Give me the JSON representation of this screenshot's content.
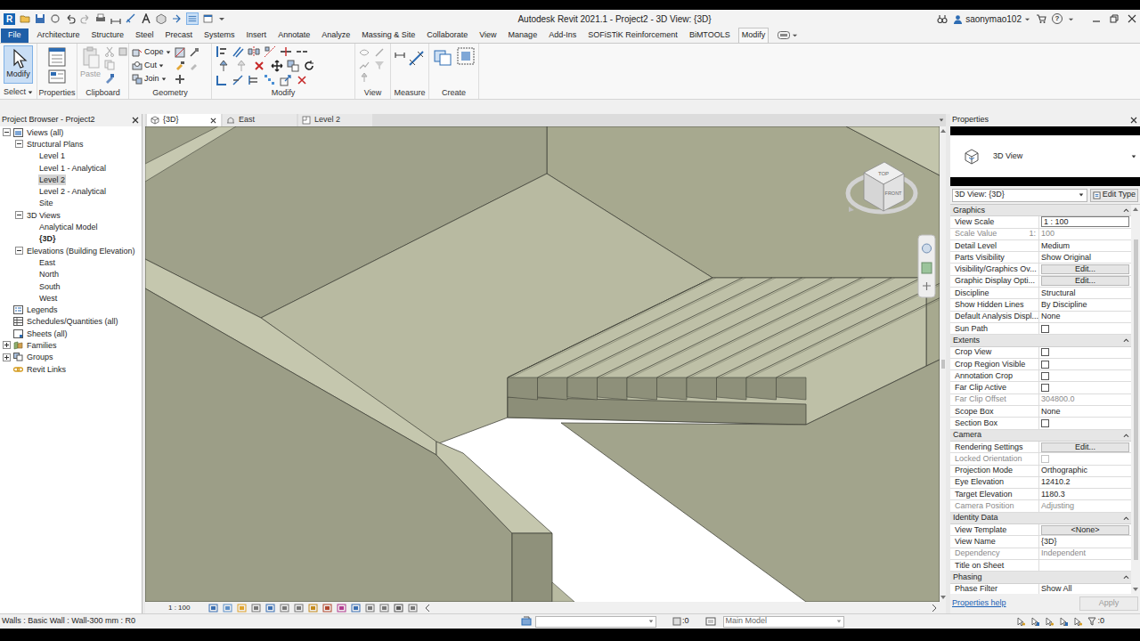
{
  "window": {
    "logo": "R",
    "title": "Autodesk Revit 2021.1 - Project2 - 3D View: {3D}",
    "user": "saonymao102",
    "help": "?"
  },
  "ribbon_tabs": [
    {
      "label": "File",
      "kind": "application",
      "selected": false
    },
    {
      "label": "Architecture",
      "kind": "tab",
      "selected": false
    },
    {
      "label": "Structure",
      "kind": "tab",
      "selected": false
    },
    {
      "label": "Steel",
      "kind": "tab",
      "selected": false
    },
    {
      "label": "Precast",
      "kind": "tab",
      "selected": false
    },
    {
      "label": "Systems",
      "kind": "tab",
      "selected": false
    },
    {
      "label": "Insert",
      "kind": "tab",
      "selected": false
    },
    {
      "label": "Annotate",
      "kind": "tab",
      "selected": false
    },
    {
      "label": "Analyze",
      "kind": "tab",
      "selected": false
    },
    {
      "label": "Massing & Site",
      "kind": "tab",
      "selected": false
    },
    {
      "label": "Collaborate",
      "kind": "tab",
      "selected": false
    },
    {
      "label": "View",
      "kind": "tab",
      "selected": false
    },
    {
      "label": "Manage",
      "kind": "tab",
      "selected": false
    },
    {
      "label": "Add-Ins",
      "kind": "tab",
      "selected": false
    },
    {
      "label": "SOFiSTiK Reinforcement",
      "kind": "tab",
      "selected": false
    },
    {
      "label": "BiMTOOLS",
      "kind": "tab",
      "selected": false
    },
    {
      "label": "Modify",
      "kind": "tab",
      "selected": true
    }
  ],
  "ribbon": {
    "select": {
      "button": "Modify",
      "button_selected": true,
      "label": "Select",
      "dropdown": true
    },
    "properties": {
      "label": "Properties"
    },
    "clipboard": {
      "paste": "Paste",
      "paste_disabled": true,
      "label": "Clipboard"
    },
    "geometry": {
      "tools": [
        {
          "label": "Cope",
          "dropdown": true
        },
        {
          "label": "Cut",
          "dropdown": true
        },
        {
          "label": "Join",
          "dropdown": true
        }
      ],
      "label": "Geometry"
    },
    "modify": {
      "label": "Modify"
    },
    "view": {
      "label": "View"
    },
    "measure": {
      "label": "Measure"
    },
    "create": {
      "label": "Create"
    }
  },
  "browser": {
    "title": "Project Browser - Project2",
    "tree": [
      {
        "label": "Views (all)",
        "kind": "views",
        "expanded": true,
        "selected": false,
        "open": false,
        "children": [
          {
            "label": "Structural Plans",
            "kind": "folder",
            "expanded": true,
            "selected": false,
            "open": false,
            "children": [
              {
                "label": "Level 1",
                "kind": "view",
                "selected": false,
                "open": false
              },
              {
                "label": "Level 1 - Analytical",
                "kind": "view",
                "selected": false,
                "open": false
              },
              {
                "label": "Level 2",
                "kind": "view",
                "selected": true,
                "open": false
              },
              {
                "label": "Level 2 - Analytical",
                "kind": "view",
                "selected": false,
                "open": false
              },
              {
                "label": "Site",
                "kind": "view",
                "selected": false,
                "open": false
              }
            ]
          },
          {
            "label": "3D Views",
            "kind": "folder",
            "expanded": true,
            "selected": false,
            "open": false,
            "children": [
              {
                "label": "Analytical Model",
                "kind": "view",
                "selected": false,
                "open": false
              },
              {
                "label": "{3D}",
                "kind": "view",
                "selected": false,
                "open": true
              }
            ]
          },
          {
            "label": "Elevations (Building Elevation)",
            "kind": "folder",
            "expanded": true,
            "selected": false,
            "open": false,
            "children": [
              {
                "label": "East",
                "kind": "view",
                "selected": false,
                "open": false
              },
              {
                "label": "North",
                "kind": "view",
                "selected": false,
                "open": false
              },
              {
                "label": "South",
                "kind": "view",
                "selected": false,
                "open": false
              },
              {
                "label": "West",
                "kind": "view",
                "selected": false,
                "open": false
              }
            ]
          }
        ]
      },
      {
        "label": "Legends",
        "kind": "legends",
        "selected": false,
        "open": false
      },
      {
        "label": "Schedules/Quantities (all)",
        "kind": "schedules",
        "selected": false,
        "open": false
      },
      {
        "label": "Sheets (all)",
        "kind": "sheets",
        "selected": false,
        "open": false
      },
      {
        "label": "Families",
        "kind": "families",
        "expanded": false,
        "selected": false,
        "open": false
      },
      {
        "label": "Groups",
        "kind": "groups",
        "expanded": false,
        "selected": false,
        "open": false
      },
      {
        "label": "Revit Links",
        "kind": "links",
        "selected": false,
        "open": false
      }
    ]
  },
  "view_tabs": [
    {
      "label": "{3D}",
      "kind": "3d",
      "selected": true,
      "closable": true
    },
    {
      "label": "East",
      "kind": "elevation",
      "selected": false,
      "closable": false
    },
    {
      "label": "Level 2",
      "kind": "plan",
      "selected": false,
      "closable": false
    }
  ],
  "view_cube": {
    "top": "TOP",
    "front": "FRONT"
  },
  "view_bar": {
    "scale": "1 : 100"
  },
  "properties": {
    "title": "Properties",
    "type_name": "3D View",
    "selector": "3D View: {3D}",
    "edit_type": "Edit Type",
    "sections": [
      {
        "name": "Graphics",
        "expanded": true,
        "rows": [
          {
            "label": "View Scale",
            "kind": "input",
            "value": "1 : 100",
            "disabled": false
          },
          {
            "label": "Scale Value",
            "unit": "1:",
            "kind": "text",
            "value": "100",
            "disabled": true
          },
          {
            "label": "Detail Level",
            "kind": "text",
            "value": "Medium",
            "disabled": false
          },
          {
            "label": "Parts Visibility",
            "kind": "text",
            "value": "Show Original",
            "disabled": false
          },
          {
            "label": "Visibility/Graphics Ov...",
            "kind": "button",
            "value": "Edit...",
            "disabled": false
          },
          {
            "label": "Graphic Display Opti...",
            "kind": "button",
            "value": "Edit...",
            "disabled": false
          },
          {
            "label": "Discipline",
            "kind": "text",
            "value": "Structural",
            "disabled": false
          },
          {
            "label": "Show Hidden Lines",
            "kind": "text",
            "value": "By Discipline",
            "disabled": false
          },
          {
            "label": "Default Analysis Displ...",
            "kind": "text",
            "value": "None",
            "disabled": false
          },
          {
            "label": "Sun Path",
            "kind": "check",
            "checked": false,
            "disabled": false
          }
        ]
      },
      {
        "name": "Extents",
        "expanded": true,
        "rows": [
          {
            "label": "Crop View",
            "kind": "check",
            "checked": false,
            "disabled": false
          },
          {
            "label": "Crop Region Visible",
            "kind": "check",
            "checked": false,
            "disabled": false
          },
          {
            "label": "Annotation Crop",
            "kind": "check",
            "checked": false,
            "disabled": false
          },
          {
            "label": "Far Clip Active",
            "kind": "check",
            "checked": false,
            "disabled": false
          },
          {
            "label": "Far Clip Offset",
            "kind": "text",
            "value": "304800.0",
            "disabled": true
          },
          {
            "label": "Scope Box",
            "kind": "text",
            "value": "None",
            "disabled": false
          },
          {
            "label": "Section Box",
            "kind": "check",
            "checked": false,
            "disabled": false
          }
        ]
      },
      {
        "name": "Camera",
        "expanded": true,
        "rows": [
          {
            "label": "Rendering Settings",
            "kind": "button",
            "value": "Edit...",
            "disabled": false
          },
          {
            "label": "Locked Orientation",
            "kind": "check",
            "checked": false,
            "disabled": true
          },
          {
            "label": "Projection Mode",
            "kind": "text",
            "value": "Orthographic",
            "disabled": false
          },
          {
            "label": "Eye Elevation",
            "kind": "text",
            "value": "12410.2",
            "disabled": false
          },
          {
            "label": "Target Elevation",
            "kind": "text",
            "value": "1180.3",
            "disabled": false
          },
          {
            "label": "Camera Position",
            "kind": "text",
            "value": "Adjusting",
            "disabled": true
          }
        ]
      },
      {
        "name": "Identity Data",
        "expanded": true,
        "rows": [
          {
            "label": "View Template",
            "kind": "button",
            "value": "<None>",
            "disabled": false
          },
          {
            "label": "View Name",
            "kind": "text",
            "value": "{3D}",
            "disabled": false
          },
          {
            "label": "Dependency",
            "kind": "text",
            "value": "Independent",
            "disabled": true
          },
          {
            "label": "Title on Sheet",
            "kind": "text",
            "value": "",
            "disabled": false
          }
        ]
      },
      {
        "name": "Phasing",
        "expanded": true,
        "rows": [
          {
            "label": "Phase Filter",
            "kind": "text",
            "value": "Show All",
            "disabled": false
          }
        ]
      }
    ],
    "help": "Properties help",
    "apply": "Apply",
    "apply_disabled": true
  },
  "status_bar": {
    "message": "Walls : Basic Wall : Wall-300 mm : R0",
    "workset": ":0",
    "model": "Main Model",
    "filter": ":0"
  }
}
